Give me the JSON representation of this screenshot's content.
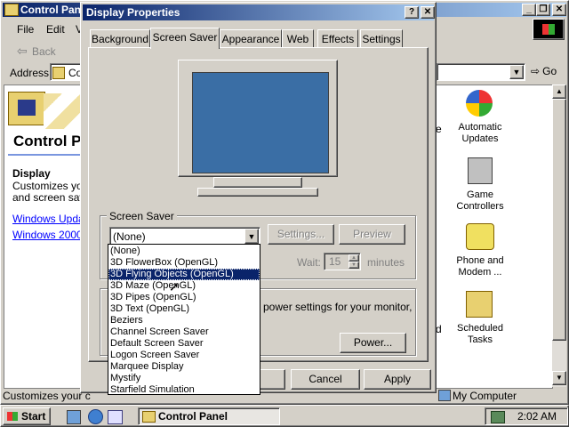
{
  "cp": {
    "title": "Control Panel",
    "menu": [
      "File",
      "Edit",
      "Vi"
    ],
    "back_label": "Back",
    "address_label": "Address",
    "address_value": "Co",
    "go_label": "Go",
    "heading": "Control P",
    "display_heading": "Display",
    "display_desc_1": "Customizes you",
    "display_desc_2": "and screen save",
    "links": [
      "Windows Updat",
      "Windows 2000 S"
    ],
    "icons": [
      {
        "label": "Automatic Updates",
        "icon": "windows-update-icon"
      },
      {
        "label": "Game Controllers",
        "icon": "joystick-icon"
      },
      {
        "label": "Phone and Modem ...",
        "icon": "phone-icon"
      },
      {
        "label": "Scheduled Tasks",
        "icon": "scheduled-tasks-icon"
      }
    ],
    "status_left": "Customizes your c",
    "status_right": "My Computer",
    "partial_e": "e",
    "partial_d": "d"
  },
  "dialog": {
    "title": "Display Properties",
    "help_btn": "?",
    "close_btn": "✕",
    "tabs": [
      "Background",
      "Screen Saver",
      "Appearance",
      "Web",
      "Effects",
      "Settings"
    ],
    "active_tab": 1,
    "group_label": "Screen Saver",
    "selected_saver": "(None)",
    "settings_btn": "Settings...",
    "preview_btn": "Preview",
    "wait_label": "Wait:",
    "wait_value": "15",
    "minutes_label": "minutes",
    "energy_text": "power settings for your monitor,",
    "power_btn": "Power...",
    "cancel_btn": "Cancel",
    "apply_btn": "Apply",
    "dropdown_items": [
      "(None)",
      "3D FlowerBox (OpenGL)",
      "3D Flying Objects (OpenGL)",
      "3D Maze (OpenGL)",
      "3D Pipes (OpenGL)",
      "3D Text (OpenGL)",
      "Beziers",
      "Channel Screen Saver",
      "Default Screen Saver",
      "Logon Screen Saver",
      "Marquee Display",
      "Mystify",
      "Starfield Simulation"
    ],
    "highlighted_index": 2,
    "monitor_screen_color": "#3a6ea5"
  },
  "taskbar": {
    "start_label": "Start",
    "task_label": "Control Panel",
    "clock": "2:02 AM"
  }
}
